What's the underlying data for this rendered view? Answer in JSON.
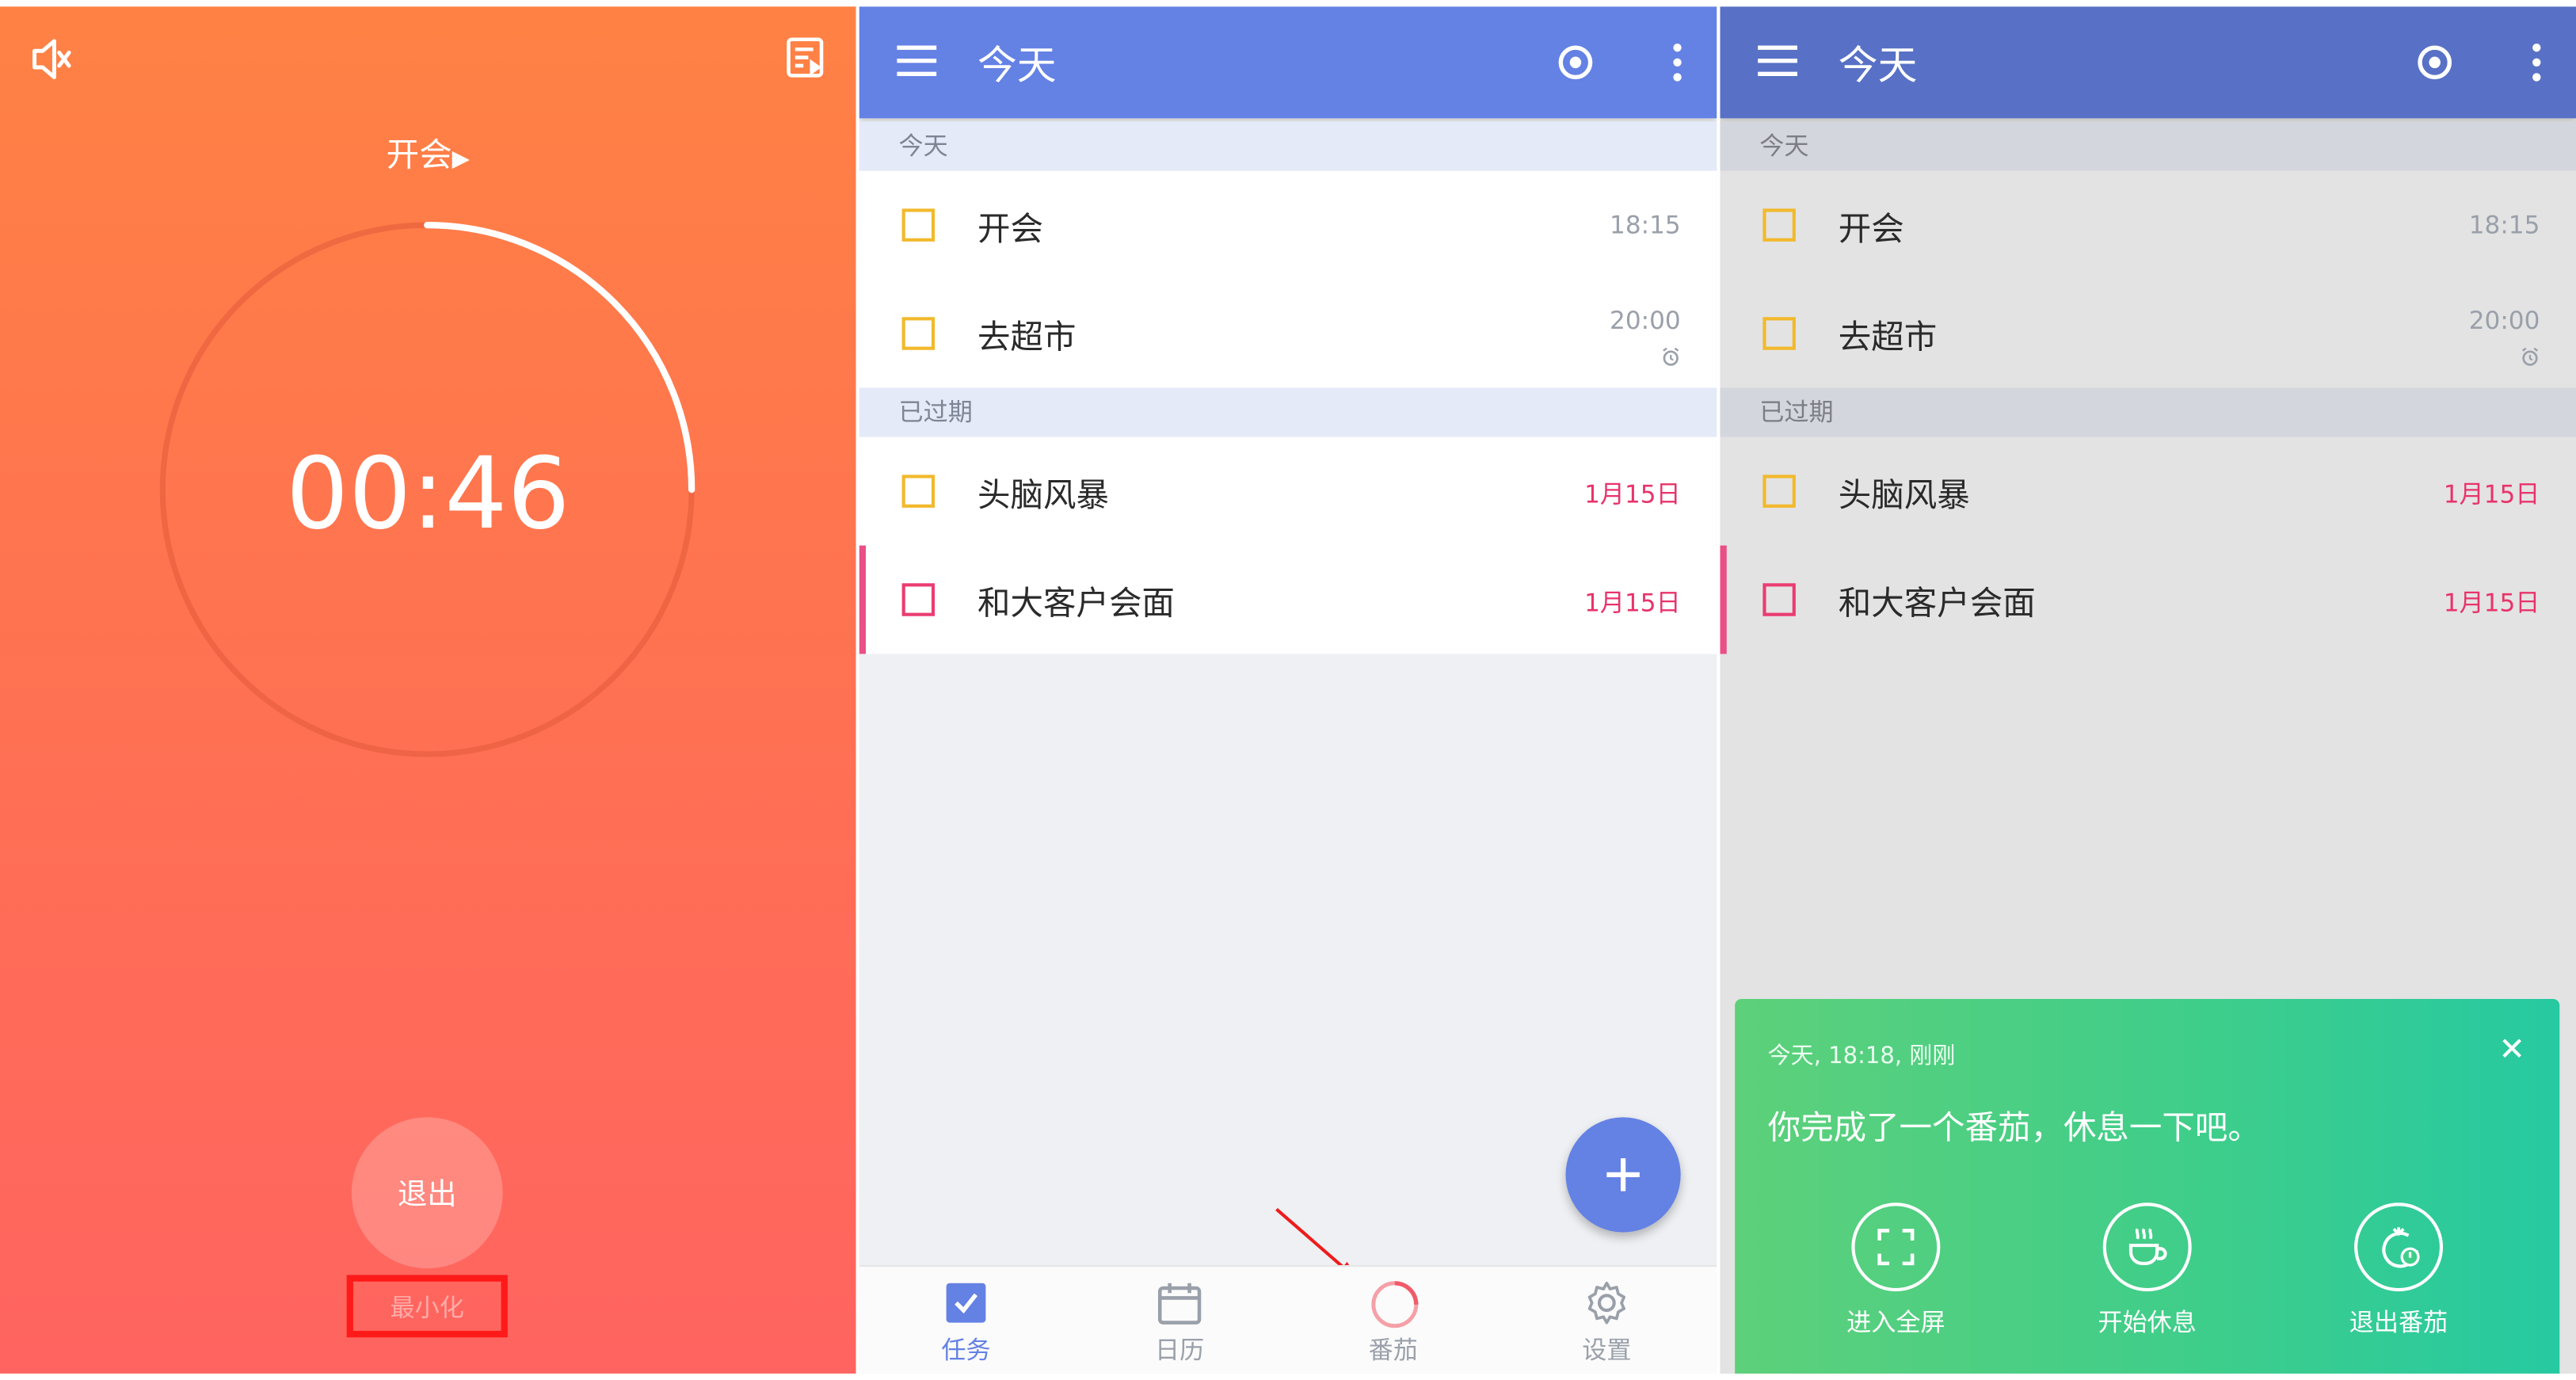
{
  "panel1": {
    "task_title": "开会",
    "timer": "00:46",
    "progress": 0.25,
    "exit_label": "退出",
    "minimize_label": "最小化"
  },
  "list": {
    "header_title": "今天",
    "sections": [
      {
        "title": "今天"
      },
      {
        "title": "已过期"
      }
    ],
    "tasks": [
      {
        "label": "开会",
        "time": "18:15"
      },
      {
        "label": "去超市",
        "time": "20:00"
      },
      {
        "label": "头脑风暴",
        "date": "1月15日"
      },
      {
        "label": "和大客户会面",
        "date": "1月15日"
      }
    ],
    "nav": [
      {
        "label": "任务",
        "icon": "checkbox-icon"
      },
      {
        "label": "日历",
        "icon": "calendar-icon"
      },
      {
        "label": "番茄",
        "icon": "pomodoro-icon"
      },
      {
        "label": "设置",
        "icon": "gear-icon"
      }
    ]
  },
  "dialog": {
    "meta": "今天, 18:18, 刚刚",
    "message": "你完成了一个番茄，休息一下吧。",
    "actions": [
      {
        "label": "进入全屏",
        "icon": "fullscreen-icon"
      },
      {
        "label": "开始休息",
        "icon": "coffee-icon"
      },
      {
        "label": "退出番茄",
        "icon": "tomato-exit-icon"
      }
    ]
  },
  "colors": {
    "primary": "#6481e4",
    "timer_bg_top": "#ff8244",
    "timer_bg_bottom": "#ff6460",
    "checkbox_yellow": "#f2b92c",
    "overdue_red": "#e8336b",
    "dialog_green": "#3fce8a"
  }
}
